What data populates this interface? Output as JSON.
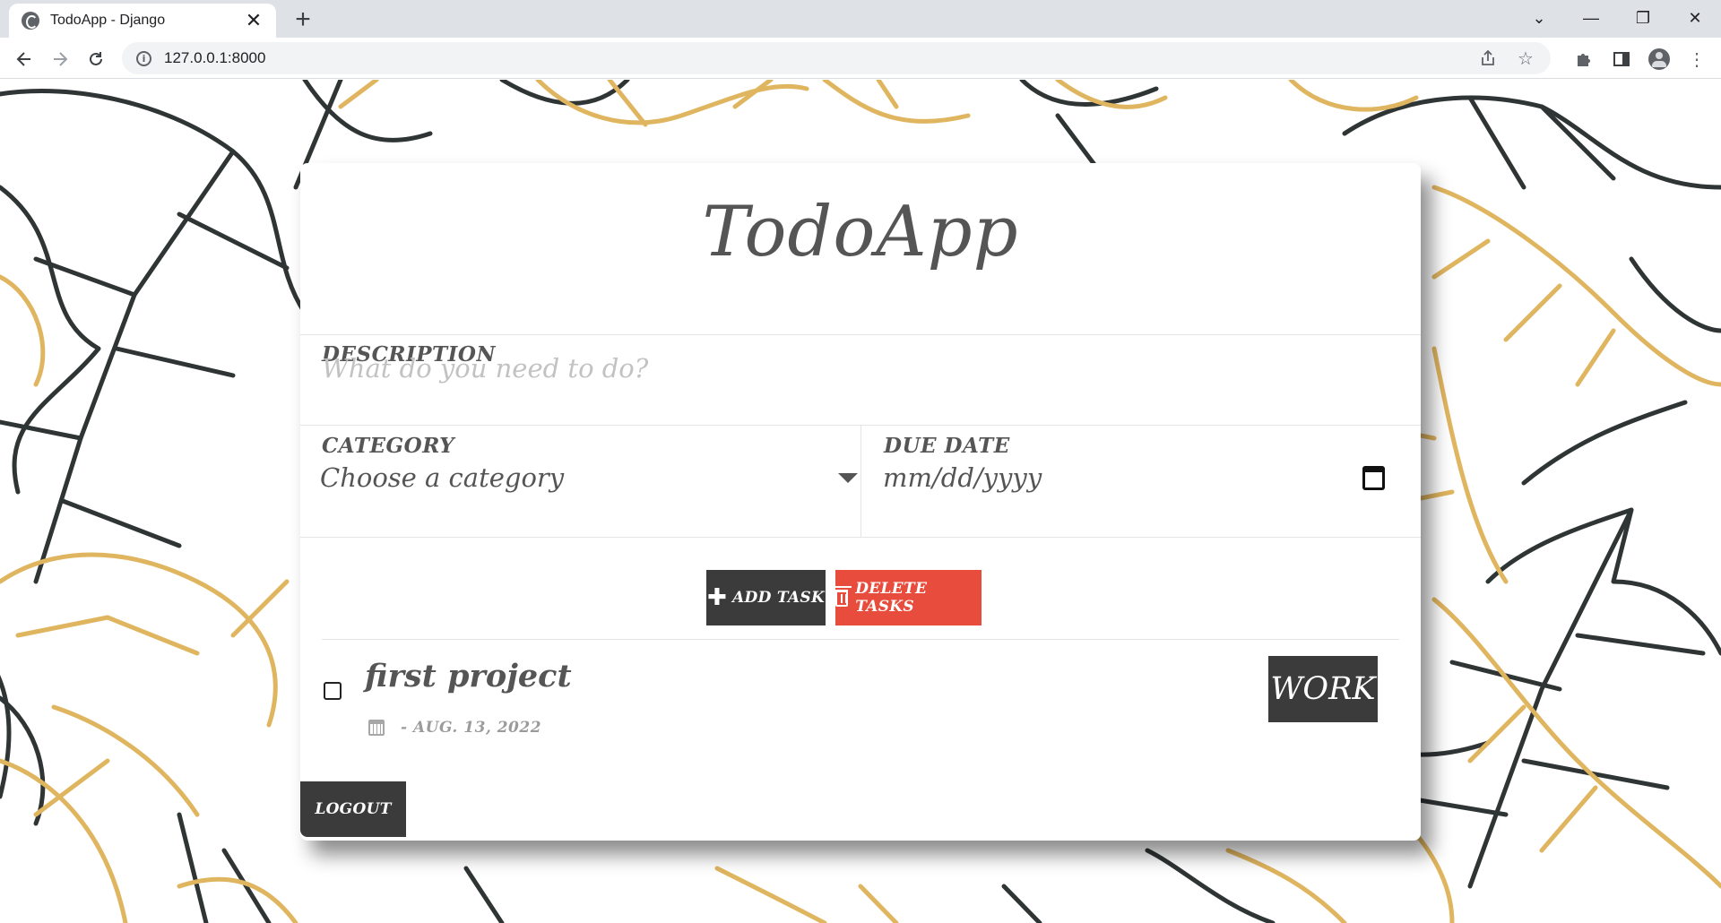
{
  "browser": {
    "tab_title": "TodoApp - Django",
    "tab_close": "✕",
    "new_tab": "+",
    "url": "127.0.0.1:8000",
    "window_controls": [
      "⌄",
      "—",
      "❐",
      "✕"
    ]
  },
  "app": {
    "title": "TodoApp",
    "description_label": "DESCRIPTION",
    "description_placeholder": "What do you need to do?",
    "category_label": "CATEGORY",
    "category_selected": "Choose a category",
    "due_date_label": "DUE DATE",
    "due_date_placeholder": "mm/dd/yyyy",
    "add_button": "ADD TASK",
    "delete_button": "DELETE TASKS",
    "logout_button": "LOGOUT"
  },
  "tasks": [
    {
      "description": "first project",
      "date": "- AUG. 13, 2022",
      "category": "WORK",
      "done": false
    }
  ],
  "colors": {
    "accent_dark": "#3b3b3b",
    "danger": "#e74c3c",
    "leaf_gold": "#e0b55f",
    "leaf_dark": "#2f3434"
  }
}
